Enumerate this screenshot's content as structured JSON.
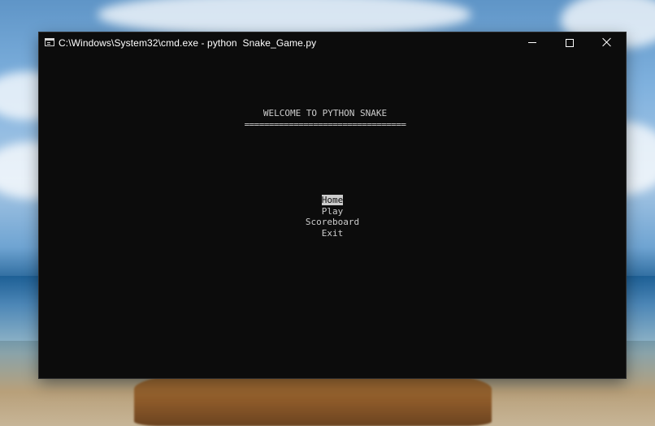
{
  "window": {
    "title": "C:\\Windows\\System32\\cmd.exe - python  Snake_Game.py"
  },
  "console": {
    "heading": "WELCOME TO PYTHON SNAKE",
    "rule": "=================================",
    "menu": [
      {
        "label": "Home",
        "selected": true
      },
      {
        "label": "Play",
        "selected": false
      },
      {
        "label": "Scoreboard",
        "selected": false
      },
      {
        "label": "Exit",
        "selected": false
      }
    ]
  },
  "icons": {
    "app": "cmd-icon",
    "minimize": "minimize-icon",
    "maximize": "maximize-icon",
    "close": "close-icon"
  }
}
